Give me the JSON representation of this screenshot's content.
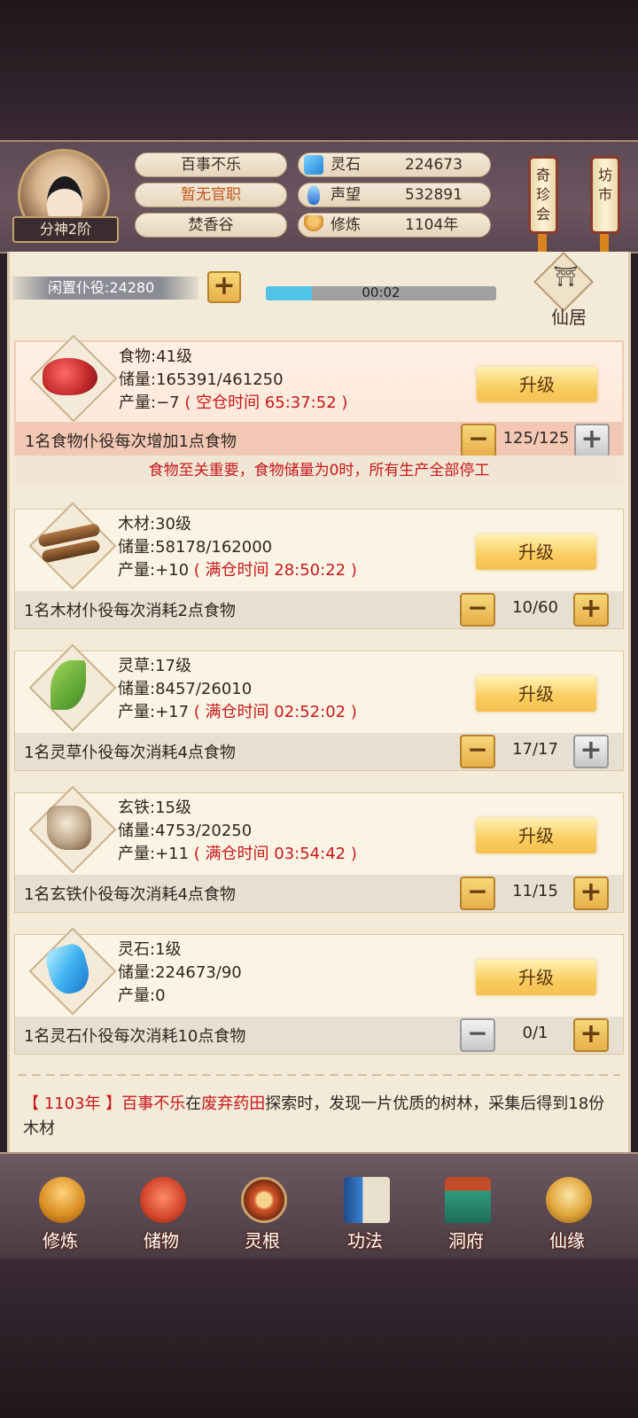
{
  "header": {
    "avatar_badge": "分神2阶",
    "player_name": "百事不乐",
    "official_title": "暂无官职",
    "sect": "焚香谷",
    "stats": [
      {
        "label": "灵石",
        "value": "224673",
        "icon": "spirit-stone-icon",
        "color": "#3a9ee6"
      },
      {
        "label": "声望",
        "value": "532891",
        "icon": "reputation-icon",
        "color": "#3a7fd6"
      },
      {
        "label": "修炼",
        "value": "1104年",
        "icon": "meditation-icon",
        "color": "#d79a3a"
      }
    ],
    "side_buttons": [
      "奇珍会",
      "坊市"
    ]
  },
  "idle_bar": {
    "label": "闲置仆役:24280",
    "timer": "00:02",
    "progress": 0.2
  },
  "xianju_label": "仙居",
  "resources": [
    {
      "name": "食物",
      "level_line": "食物:41级",
      "storage_line": "储量:165391/461250",
      "output_prefix": "产量:−7",
      "output_note": "( 空仓时间 65:37:52 )",
      "upgrade_label": "升级",
      "desc": "1名食物仆役每次增加1点食物",
      "count": "125/125",
      "icon": "raw-meat-icon"
    },
    {
      "name": "木材",
      "level_line": "木材:30级",
      "storage_line": "储量:58178/162000",
      "output_prefix": "产量:+10",
      "output_note": "( 满仓时间 28:50:22 )",
      "upgrade_label": "升级",
      "desc": "1名木材仆役每次消耗2点食物",
      "count": "10/60",
      "icon": "wood-logs-icon"
    },
    {
      "name": "灵草",
      "level_line": "灵草:17级",
      "storage_line": "储量:8457/26010",
      "output_prefix": "产量:+17",
      "output_note": "( 满仓时间 02:52:02 )",
      "upgrade_label": "升级",
      "desc": "1名灵草仆役每次消耗4点食物",
      "count": "17/17",
      "icon": "herb-icon"
    },
    {
      "name": "玄铁",
      "level_line": "玄铁:15级",
      "storage_line": "储量:4753/20250",
      "output_prefix": "产量:+11",
      "output_note": "( 满仓时间 03:54:42 )",
      "upgrade_label": "升级",
      "desc": "1名玄铁仆役每次消耗4点食物",
      "count": "11/15",
      "icon": "iron-ore-icon"
    },
    {
      "name": "灵石",
      "level_line": "灵石:1级",
      "storage_line": "储量:224673/90",
      "output_prefix": "产量:0",
      "output_note": "",
      "upgrade_label": "升级",
      "desc": "1名灵石仆役每次消耗10点食物",
      "count": "0/1",
      "icon": "spirit-stone-crystal-icon"
    }
  ],
  "food_warning": "食物至关重要，食物储量为0时，所有生产全部停工",
  "log": {
    "year": "【 1103年 】",
    "name": "百事不乐",
    "t1": "在",
    "place": "废弃药田",
    "t2": "探索时，发现一片优质的树林，采集后得到18份木材"
  },
  "nav": [
    {
      "label": "修炼",
      "icon": "cultivation-monk-icon"
    },
    {
      "label": "储物",
      "icon": "storage-bag-icon"
    },
    {
      "label": "灵根",
      "icon": "spirit-root-icon"
    },
    {
      "label": "功法",
      "icon": "scripture-book-icon"
    },
    {
      "label": "洞府",
      "icon": "cave-mansion-icon"
    },
    {
      "label": "仙缘",
      "icon": "immortal-fate-icon"
    }
  ],
  "plus_symbol": "+",
  "minus_symbol": "−"
}
